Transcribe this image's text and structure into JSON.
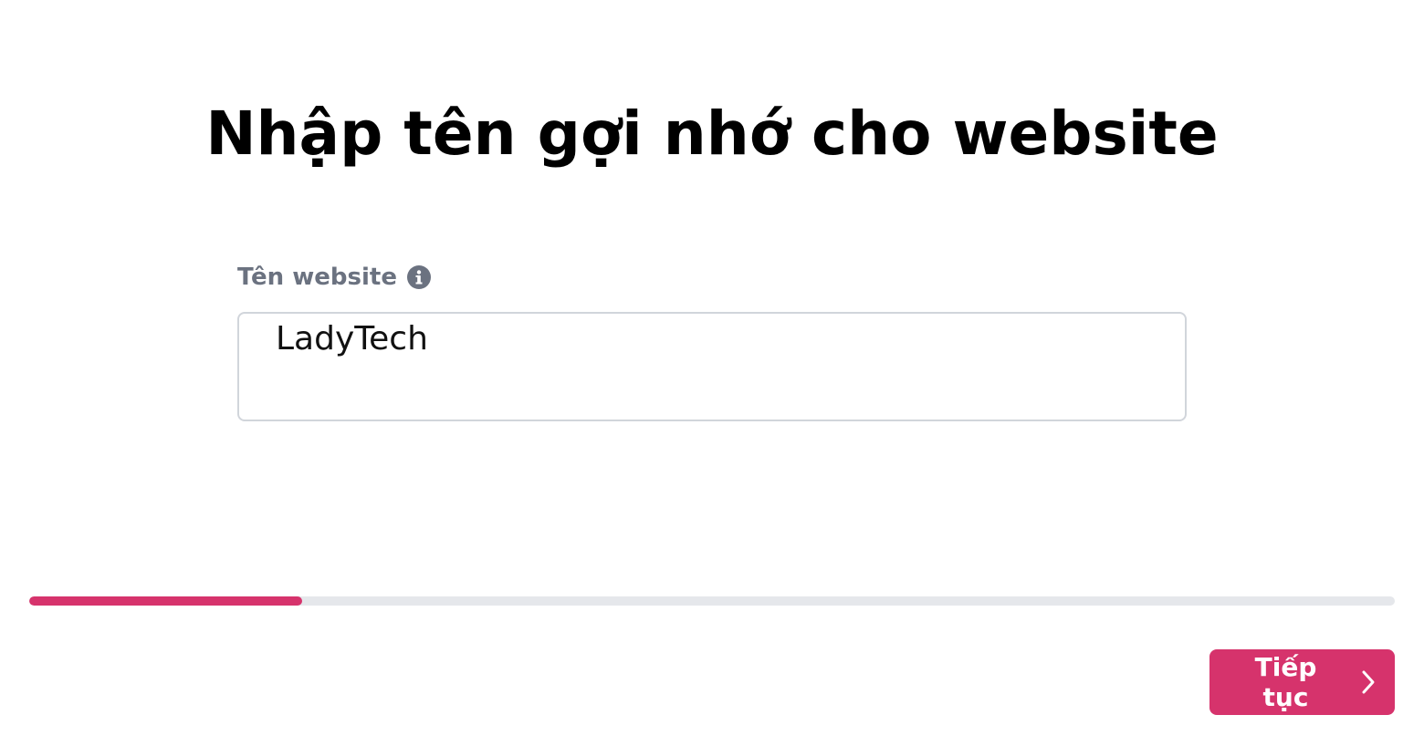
{
  "header": {
    "title": "Nhập tên gợi nhớ cho website"
  },
  "form": {
    "field_label": "Tên website",
    "info_icon": "info-circle-icon",
    "input_value": "LadyTech"
  },
  "progress": {
    "fraction": 0.2
  },
  "footer": {
    "continue_label": "Tiếp tục",
    "continue_icon": "chevron-right-icon"
  },
  "colors": {
    "accent": "#d6336c",
    "label_gray": "#6b7280",
    "track": "#e5e7eb",
    "border": "#d1d5db"
  }
}
